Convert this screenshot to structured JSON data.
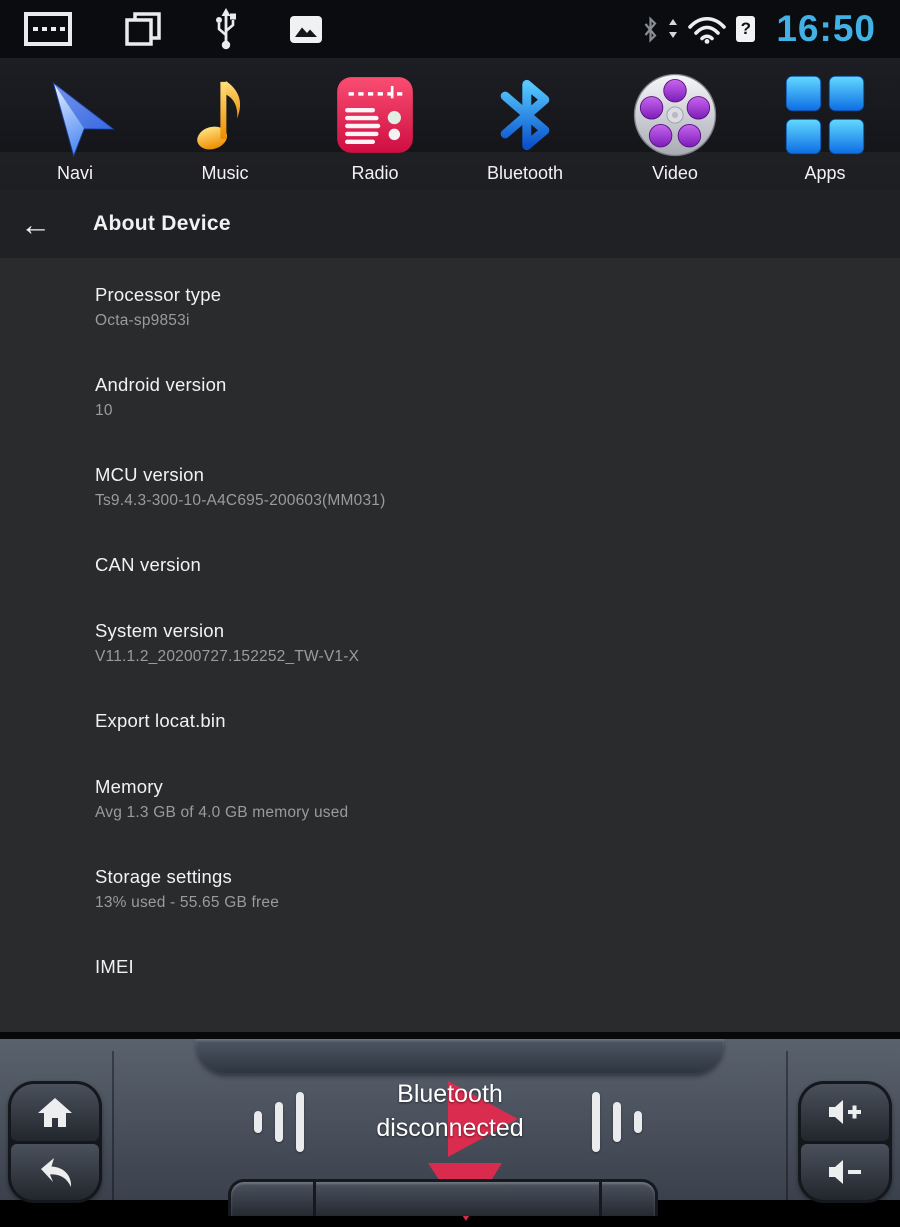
{
  "status_bar": {
    "time": "16:50",
    "time_color": "#41b1e6",
    "sim_badge": "?",
    "icons_left": [
      "keyboard-hide-icon",
      "recent-apps-icon",
      "usb-icon",
      "screenshot-icon"
    ],
    "icons_right": [
      "bluetooth-icon",
      "network-arrows-icon",
      "wifi-icon",
      "sim-unknown-badge"
    ]
  },
  "dock": {
    "items": [
      {
        "label": "Navi",
        "icon": "navigation-arrow-icon"
      },
      {
        "label": "Music",
        "icon": "music-note-icon"
      },
      {
        "label": "Radio",
        "icon": "radio-icon"
      },
      {
        "label": "Bluetooth",
        "icon": "bluetooth-icon"
      },
      {
        "label": "Video",
        "icon": "film-reel-icon"
      },
      {
        "label": "Apps",
        "icon": "app-grid-icon"
      }
    ]
  },
  "header": {
    "back_glyph": "←",
    "title": "About Device"
  },
  "settings": {
    "items": [
      {
        "title": "Processor type",
        "subtitle": "Octa-sp9853i"
      },
      {
        "title": "Android version",
        "subtitle": "10"
      },
      {
        "title": "MCU version",
        "subtitle": "Ts9.4.3-300-10-A4C695-200603(MM031)"
      },
      {
        "title": "CAN version",
        "subtitle": ""
      },
      {
        "title": "System version",
        "subtitle": "V11.1.2_20200727.152252_TW-V1-X"
      },
      {
        "title": "Export locat.bin",
        "subtitle": ""
      },
      {
        "title": "Memory",
        "subtitle": "Avg 1.3 GB of 4.0 GB memory used"
      },
      {
        "title": "Storage settings",
        "subtitle": "13% used - 55.65 GB free"
      },
      {
        "title": "IMEI",
        "subtitle": ""
      }
    ]
  },
  "bottom_bar": {
    "status_line1": "Bluetooth",
    "status_line2": "disconnected",
    "accent_red": "#e22a4e",
    "buttons": [
      "home-button",
      "back-button",
      "volume-up-button",
      "volume-down-button"
    ]
  }
}
